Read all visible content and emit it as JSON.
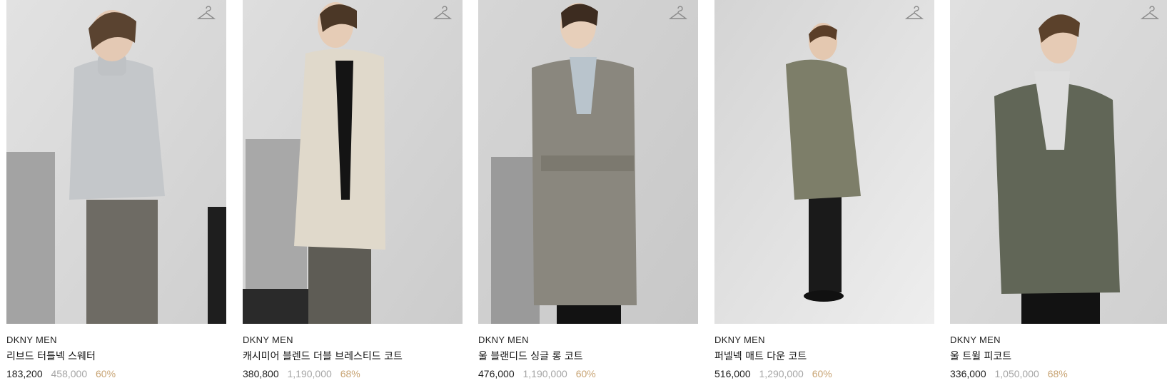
{
  "products": [
    {
      "brand": "DKNY MEN",
      "name": "리브드 터틀넥 스웨터",
      "sale_price": "183,200",
      "original_price": "458,000",
      "discount": "60%",
      "icon": "hanger-icon"
    },
    {
      "brand": "DKNY MEN",
      "name": "캐시미어 블렌드 더블 브레스티드 코트",
      "sale_price": "380,800",
      "original_price": "1,190,000",
      "discount": "68%",
      "icon": "hanger-icon"
    },
    {
      "brand": "DKNY MEN",
      "name": "울 블랜디드 싱글 롱 코트",
      "sale_price": "476,000",
      "original_price": "1,190,000",
      "discount": "60%",
      "icon": "hanger-icon"
    },
    {
      "brand": "DKNY MEN",
      "name": "퍼넬넥 매트 다운 코트",
      "sale_price": "516,000",
      "original_price": "1,290,000",
      "discount": "60%",
      "icon": "hanger-icon"
    },
    {
      "brand": "DKNY MEN",
      "name": "울 트윌 피코트",
      "sale_price": "336,000",
      "original_price": "1,050,000",
      "discount": "68%",
      "icon": "hanger-icon"
    }
  ],
  "colors": {
    "discount": "#c8a474",
    "original_price": "#a5a5a5",
    "photo_background": "#d9d9d9"
  }
}
